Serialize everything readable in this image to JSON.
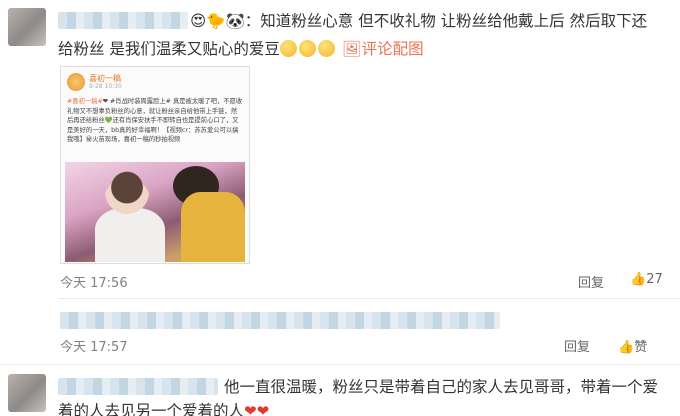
{
  "comment1": {
    "line1": "：知道粉丝心意 但不收礼物 让粉丝给他戴上后 然后取下还",
    "line2_a": "给粉丝 是我们温柔又贴心的爱豆",
    "with_image_link": "评论配图",
    "time": "今天 17:56",
    "reply_label": "回复",
    "like_count": "27",
    "image": {
      "author": "喜初一稿",
      "time": "9-28 10:30",
      "tag": "#喜初一稿#",
      "body": "❤ #肖战时装周露脸上# 真是被太暖了吧，不愿收礼物又不想辜负粉丝的心意，就让粉丝亲自给他带上手链，然后再还给粉丝💚还有肖保安扶手不即转自也是提前心口了，又是美好的一天，bb真的好幸福啊！【视频cr：苏苏爱公可以搞我哦】㊙火苗现场，喜初一稿的秒拍视频"
    }
  },
  "comment2": {
    "time": "今天 17:57",
    "reply_label": "回复",
    "like_label": "赞"
  },
  "comment3": {
    "line1": "他一直很温暖，粉丝只是带着自己的家人去见哥哥，带着一个爱",
    "line2": "着的人去见另一个爱着的人"
  },
  "colors": {
    "link": "#eb7350",
    "text": "#333333",
    "meta": "#808080",
    "heart": "#e23a2e"
  },
  "icons": [
    "comment-icon",
    "like-thumb-icon",
    "heart-icon",
    "smile-emoji-icon"
  ]
}
